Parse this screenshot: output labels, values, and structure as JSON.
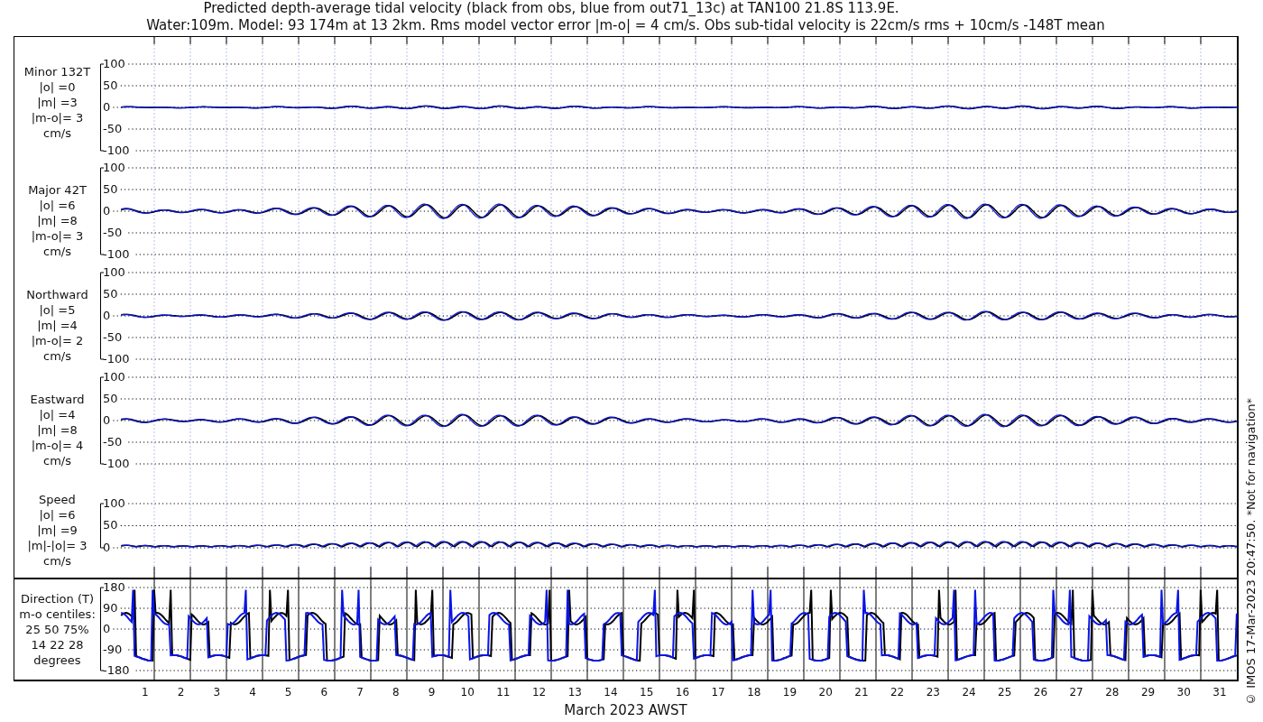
{
  "title": {
    "line_1": "Predicted depth-average tidal velocity (black from obs, blue from out71_13c) at TAN100 21.8S 113.9E.",
    "line_2": "Water:109m. Model: 93 174m at 13 2km. Rms model vector error |m-o| = 4 cm/s. Obs sub-tidal velocity is 22cm/s rms + 10cm/s -148T mean"
  },
  "panels": [
    {
      "kind": "signed",
      "label_lines": [
        "Minor 132T",
        "|o| =0",
        "|m| =3",
        "|m-o|= 3",
        "cm/s"
      ],
      "yticks": [
        "100",
        "50",
        "0",
        "-50",
        "-100"
      ]
    },
    {
      "kind": "signed",
      "label_lines": [
        "Major 42T",
        "|o| =6",
        "|m| =8",
        "|m-o|= 3",
        "cm/s"
      ],
      "yticks": [
        "100",
        "50",
        "0",
        "-50",
        "-100"
      ]
    },
    {
      "kind": "signed",
      "label_lines": [
        "Northward",
        "|o| =5",
        "|m| =4",
        "|m-o|= 2",
        "cm/s"
      ],
      "yticks": [
        "100",
        "50",
        "0",
        "-50",
        "-100"
      ]
    },
    {
      "kind": "signed",
      "label_lines": [
        "Eastward",
        "|o| =4",
        "|m| =8",
        "|m-o|= 4",
        "cm/s"
      ],
      "yticks": [
        "100",
        "50",
        "0",
        "-50",
        "-100"
      ]
    },
    {
      "kind": "speed",
      "label_lines": [
        "Speed",
        "|o| =6",
        "|m| =9",
        "|m|-|o|= 3",
        "cm/s"
      ],
      "yticks": [
        "100",
        "50",
        "0"
      ]
    },
    {
      "kind": "direction",
      "label_lines": [
        "Direction (T)",
        "m-o centiles:",
        "25  50  75%",
        "14  22  28",
        "degrees"
      ],
      "yticks": [
        "180",
        "90",
        "0",
        "-90",
        "-180"
      ]
    }
  ],
  "x_axis": {
    "day_labels": [
      "1",
      "2",
      "3",
      "4",
      "5",
      "6",
      "7",
      "8",
      "9",
      "10",
      "11",
      "12",
      "13",
      "14",
      "15",
      "16",
      "17",
      "18",
      "19",
      "20",
      "21",
      "22",
      "23",
      "24",
      "25",
      "26",
      "27",
      "28",
      "29",
      "30",
      "31"
    ],
    "title": "March 2023 AWST"
  },
  "credit": "© IMOS 17-Mar-2023 20:47:50. *Not for navigation*"
}
